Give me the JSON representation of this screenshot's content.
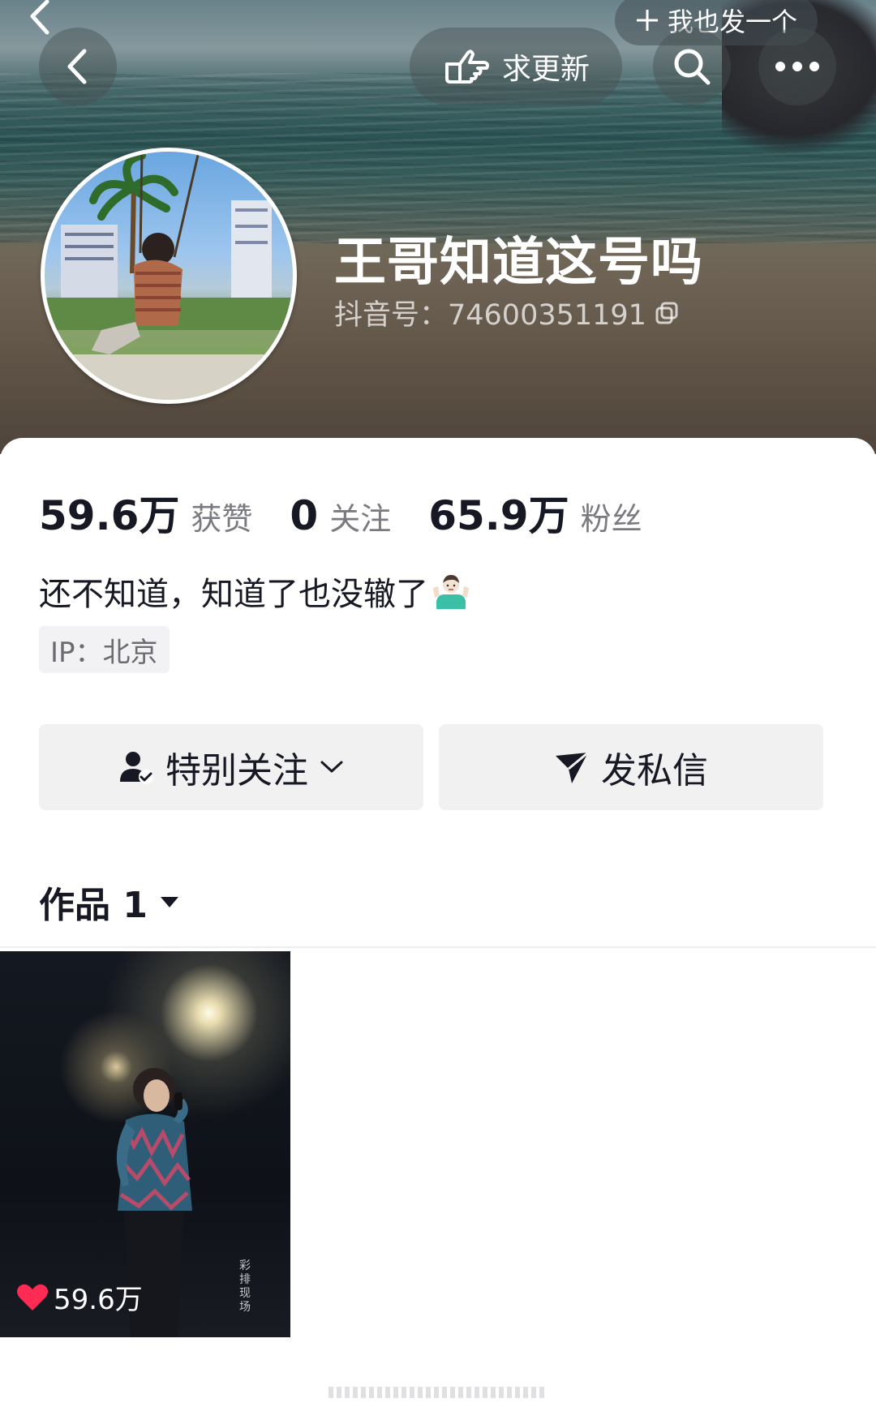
{
  "header": {
    "post_label": "我也发一个",
    "update_label": "求更新",
    "nickname": "王哥知道这号吗",
    "douyin_id": "抖音号：74600351191"
  },
  "stats": [
    {
      "value": "59.6万",
      "label": "获赞"
    },
    {
      "value": "0",
      "label": "关注"
    },
    {
      "value": "65.9万",
      "label": "粉丝"
    }
  ],
  "bio": "还不知道，知道了也没辙了",
  "ip": "IP：北京",
  "actions": {
    "follow_label": "特别关注",
    "message_label": "发私信"
  },
  "works": {
    "tab_label": "作品 1",
    "items": [
      {
        "likes": "59.6万",
        "tag": "彩排现场"
      }
    ]
  },
  "colors": {
    "like_heart": "#fe2c55",
    "button_bg": "#f1f1f2"
  }
}
